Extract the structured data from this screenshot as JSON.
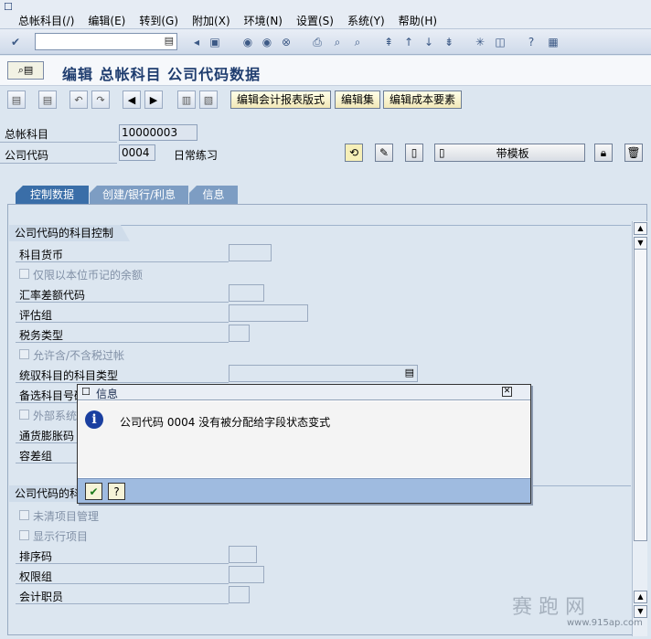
{
  "menubar": {
    "items": [
      "总帐科目(/)",
      "编辑(E)",
      "转到(G)",
      "附加(X)",
      "环境(N)",
      "设置(S)",
      "系统(Y)",
      "帮助(H)"
    ]
  },
  "toolbar": {
    "command_value": "",
    "icons": [
      "check-icon",
      "save-icon",
      "back-icon",
      "exit-icon",
      "cancel-icon",
      "print-icon",
      "find-icon",
      "find-next-icon",
      "first-page-icon",
      "prev-page-icon",
      "next-page-icon",
      "last-page-icon",
      "new-session-icon",
      "shortcut-icon",
      "help-icon",
      "layout-icon"
    ]
  },
  "title": {
    "text": "编辑 总帐科目 公司代码数据"
  },
  "app_toolbar": {
    "buttons": [
      "编辑会计报表版式",
      "编辑集",
      "编辑成本要素"
    ]
  },
  "header": {
    "account_label": "总帐科目",
    "account_value": "10000003",
    "company_label": "公司代码",
    "company_value": "0004",
    "company_desc": "日常练习",
    "template_button": "带模板"
  },
  "tabs": [
    "控制数据",
    "创建/银行/利息",
    "信息"
  ],
  "group1": {
    "title": "公司代码的科目控制",
    "fields": {
      "currency": "科目货币",
      "local_only": "仅限以本位币记的余额",
      "exch_diff": "汇率差额代码",
      "valuation": "评估组",
      "tax_cat": "税务类型",
      "tax_post": "允许含/不含税过帐",
      "recon": "统驭科目的科目类型",
      "alt_acct": "备选科目号码",
      "ext_sys": "外部系统",
      "inflation": "通货膨胀码",
      "tolerance": "容差组"
    }
  },
  "group2": {
    "title": "公司代码的科目管理",
    "fields": {
      "open_items": "未清项目管理",
      "line_items": "显示行项目",
      "sort_key": "排序码",
      "auth_group": "权限组",
      "clerk": "会计职员"
    }
  },
  "dialog": {
    "title": "信息",
    "message": "公司代码 0004 没有被分配给字段状态变式"
  },
  "watermark": {
    "text": "赛 跑 网",
    "url": "www.915ap.com"
  }
}
